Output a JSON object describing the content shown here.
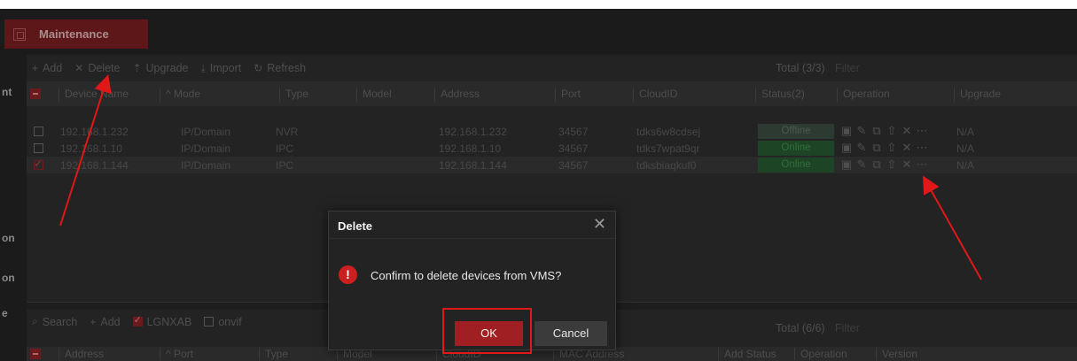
{
  "tab": {
    "label": "Maintenance"
  },
  "sidebar": {
    "fragments": [
      "nt",
      "on",
      "on",
      "e"
    ]
  },
  "toolbar": {
    "add": "Add",
    "delete": "Delete",
    "upgrade": "Upgrade",
    "import": "Import",
    "refresh": "Refresh",
    "total": "Total (3/3)",
    "filter_placeholder": "Filter"
  },
  "table": {
    "columns": [
      "Device Name",
      "Mode",
      "Type",
      "Model",
      "Address",
      "Port",
      "CloudID",
      "Status(2)",
      "Operation",
      "Upgrade"
    ],
    "rows": [
      {
        "name": "192.168.1.232",
        "mode": "IP/Domain",
        "type": "NVR",
        "model": "",
        "address": "192.168.1.232",
        "port": "34567",
        "cloud_id": "tdks6w8cdsej",
        "status": "Offline",
        "upgrade": "N/A",
        "checked": false
      },
      {
        "name": "192.168.1.10",
        "mode": "IP/Domain",
        "type": "IPC",
        "model": "",
        "address": "192.168.1.10",
        "port": "34567",
        "cloud_id": "tdks7wpat9qr",
        "status": "Online",
        "upgrade": "N/A",
        "checked": false
      },
      {
        "name": "192.168.1.144",
        "mode": "IP/Domain",
        "type": "IPC",
        "model": "",
        "address": "192.168.1.144",
        "port": "34567",
        "cloud_id": "tdksbiaqkuf0",
        "status": "Online",
        "upgrade": "N/A",
        "checked": true
      }
    ]
  },
  "search_panel": {
    "search": "Search",
    "add": "Add",
    "lgnxab": "LGNXAB",
    "onvif": "onvif",
    "total": "Total (6/6)",
    "filter_placeholder": "Filter",
    "columns": [
      "Address",
      "Port",
      "Type",
      "Model",
      "CloudID",
      "MAC Address",
      "Add Status",
      "Operation",
      "Version"
    ]
  },
  "dialog": {
    "title": "Delete",
    "message": "Confirm to delete devices from VMS?",
    "ok": "OK",
    "cancel": "Cancel"
  },
  "colors": {
    "accent": "#a01f22",
    "warning": "#cc1f1f",
    "annotation": "#e01818"
  }
}
